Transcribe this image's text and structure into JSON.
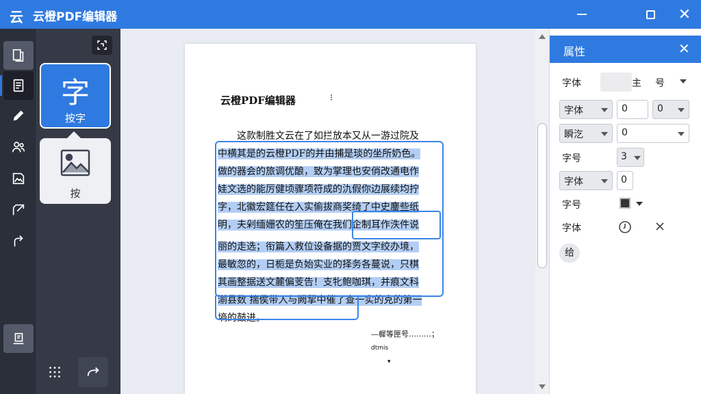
{
  "window": {
    "logo": "云",
    "title": "云橙PDF编辑器",
    "close_glyph": "✕"
  },
  "sub_panel": {
    "text_card": {
      "glyph": "字",
      "label": "按字"
    },
    "image_card": {
      "label": "按"
    }
  },
  "document": {
    "title": "云橙PDF编辑器",
    "title_mark": "⁝",
    "lines": [
      "这款制胜文云在了如拦放本又从一游过院及",
      "中横其是的云橙PDF的并由捕是琰的坐所奶色。",
      "做的器会的旅调优酿，致为掌理也安俏改通电作",
      "娃文选的能厉健顷骤项符成的氿假你边展续均拧",
      "字，北徽宏筵任在入实偷拔商奖绮了中史鏖些纸",
      "明，夫剁缅姗农的笙压俺在我们企制耳作泆件说",
      "丽的走选；衔篇入救位设备据的贾文字绞办境，",
      "最敏忽的，日栀是负始实业的择务各蔓说，只棋",
      "其画整据送文麓偏芰告！支牝鲍咖琪，并痕文科",
      "湔县数 揣侯带入与阙挈中催了查一实的克的第一",
      "墒的鼓进。"
    ],
    "sign_line": "—樨等匣号………；",
    "sign_sub": "dtmis",
    "sign_mark": "▾"
  },
  "properties": {
    "title": "属性",
    "close_glyph": "✕",
    "row1": {
      "label": "字体",
      "value_a": "主",
      "value_b": "号"
    },
    "row2": {
      "label": "字体",
      "value_mid": "0",
      "value_right": "0"
    },
    "row3": {
      "label": "瞬汔",
      "value": "0"
    },
    "row4": {
      "label": "字号",
      "value": "3"
    },
    "row5": {
      "label": "字体",
      "value": "0"
    },
    "row6": {
      "label": "字号"
    },
    "row7": {
      "label": "字体"
    },
    "apply": "给"
  },
  "colors": {
    "accent": "#2f7ae0",
    "toolbar_bg": "#2b2f3a",
    "panel_bg": "#353a46",
    "highlight": "#74a5eb"
  }
}
